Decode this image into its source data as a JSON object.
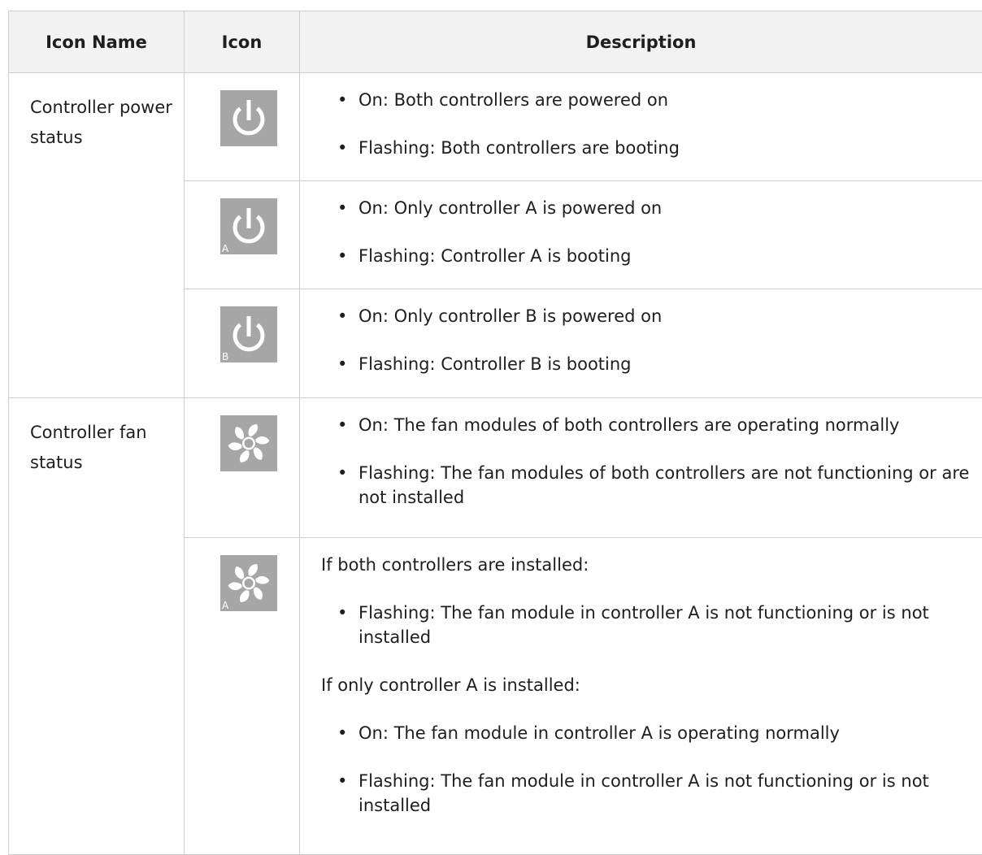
{
  "table": {
    "headers": [
      "Icon Name",
      "Icon",
      "Description"
    ],
    "groups": [
      {
        "name": "Controller power status",
        "rows": [
          {
            "icon": "power-icon",
            "icon_sub": "",
            "lines": [
              {
                "kind": "bullet",
                "text": "On: Both controllers are powered on"
              },
              {
                "kind": "bullet",
                "text": "Flashing: Both controllers are booting"
              }
            ]
          },
          {
            "icon": "power-icon",
            "icon_sub": "A",
            "lines": [
              {
                "kind": "bullet",
                "text": "On: Only controller A is powered on"
              },
              {
                "kind": "bullet",
                "text": "Flashing: Controller A is booting"
              }
            ]
          },
          {
            "icon": "power-icon",
            "icon_sub": "B",
            "lines": [
              {
                "kind": "bullet",
                "text": "On: Only controller B is powered on"
              },
              {
                "kind": "bullet",
                "text": "Flashing: Controller B is booting"
              }
            ]
          }
        ]
      },
      {
        "name": "Controller fan status",
        "rows": [
          {
            "icon": "fan-icon",
            "icon_sub": "",
            "lines": [
              {
                "kind": "bullet",
                "text": "On: The fan modules of both controllers are operating normally"
              },
              {
                "kind": "bullet",
                "text": "Flashing: The fan modules of both controllers are not functioning or are not installed"
              }
            ]
          },
          {
            "icon": "fan-icon",
            "icon_sub": "A",
            "lines": [
              {
                "kind": "para",
                "text": "If both controllers are installed:"
              },
              {
                "kind": "bullet",
                "text": "Flashing: The fan module in controller A is not functioning or is not installed"
              },
              {
                "kind": "para",
                "text": "If only controller A is installed:"
              },
              {
                "kind": "bullet",
                "text": "On: The fan module in controller A is operating normally"
              },
              {
                "kind": "bullet",
                "text": "Flashing: The fan module in controller A is not functioning or is not installed"
              }
            ]
          }
        ]
      }
    ]
  },
  "colors": {
    "header_bg": "#f2f2f2",
    "icon_bg": "#a6a6a6",
    "border": "#cfcfcf"
  }
}
